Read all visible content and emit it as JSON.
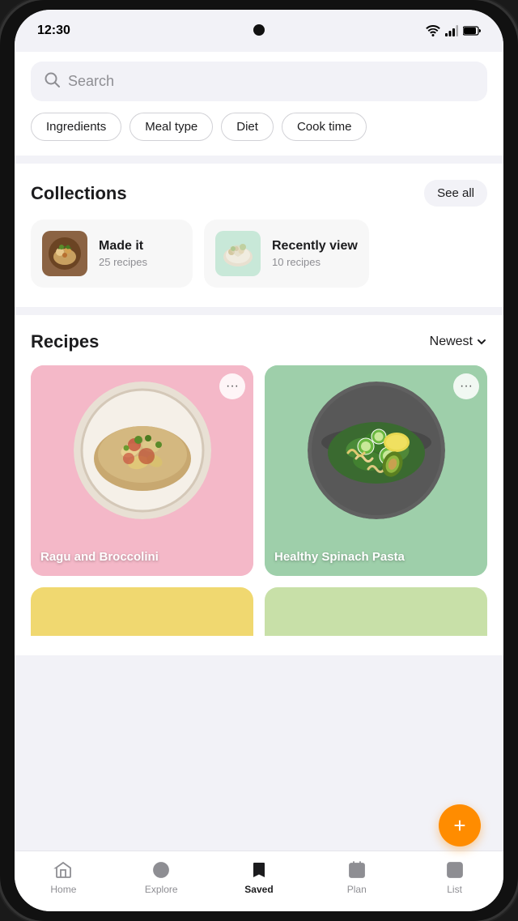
{
  "status_bar": {
    "time": "12:30"
  },
  "search": {
    "placeholder": "Search"
  },
  "filter_chips": [
    {
      "label": "Ingredients",
      "id": "ingredients"
    },
    {
      "label": "Meal type",
      "id": "meal-type"
    },
    {
      "label": "Diet",
      "id": "diet"
    },
    {
      "label": "Cook time",
      "id": "cook-time"
    }
  ],
  "collections": {
    "title": "Collections",
    "see_all": "See all",
    "items": [
      {
        "name": "Made it",
        "count": "25 recipes",
        "color": "#c8a882"
      },
      {
        "name": "Recently viewed",
        "count": "10 recipes",
        "color": "#a8d8b8"
      }
    ]
  },
  "recipes": {
    "title": "Recipes",
    "sort_label": "Newest",
    "items": [
      {
        "name": "Ragu and Broccolini",
        "bg": "pink"
      },
      {
        "name": "Healthy Spinach Pasta",
        "bg": "teal"
      },
      {
        "name": "",
        "bg": "yellow"
      }
    ]
  },
  "fab": {
    "label": "+"
  },
  "nav": {
    "items": [
      {
        "label": "Home",
        "icon": "home",
        "active": false
      },
      {
        "label": "Explore",
        "icon": "explore",
        "active": false
      },
      {
        "label": "Saved",
        "icon": "saved",
        "active": true
      },
      {
        "label": "Plan",
        "icon": "plan",
        "active": false
      },
      {
        "label": "List",
        "icon": "list",
        "active": false
      }
    ]
  }
}
